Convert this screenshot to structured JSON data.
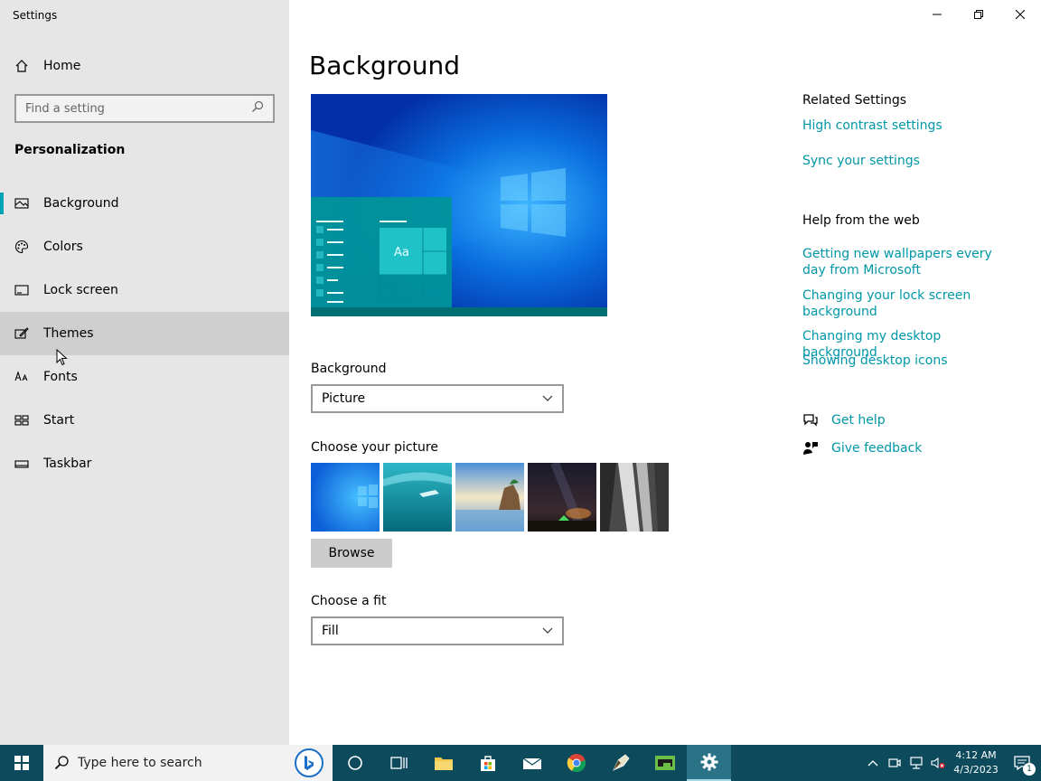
{
  "window": {
    "title": "Settings"
  },
  "sidebar": {
    "home_label": "Home",
    "search_placeholder": "Find a setting",
    "section_title": "Personalization",
    "items": [
      {
        "label": "Background",
        "icon": "picture-icon",
        "selected": true
      },
      {
        "label": "Colors",
        "icon": "palette-icon"
      },
      {
        "label": "Lock screen",
        "icon": "lock-screen-icon"
      },
      {
        "label": "Themes",
        "icon": "themes-icon",
        "hover": true
      },
      {
        "label": "Fonts",
        "icon": "fonts-icon"
      },
      {
        "label": "Start",
        "icon": "start-icon"
      },
      {
        "label": "Taskbar",
        "icon": "taskbar-icon"
      }
    ]
  },
  "main": {
    "title": "Background",
    "preview_tile_text": "Aa",
    "background_label": "Background",
    "background_value": "Picture",
    "choose_picture_label": "Choose your picture",
    "browse_label": "Browse",
    "fit_label": "Choose a fit",
    "fit_value": "Fill"
  },
  "right_pane": {
    "related_title": "Related Settings",
    "related_links": [
      "High contrast settings",
      "Sync your settings"
    ],
    "help_title": "Help from the web",
    "help_links": [
      "Getting new wallpapers every day from Microsoft",
      "Changing your lock screen background",
      "Changing my desktop background",
      "Showing desktop icons"
    ],
    "get_help": "Get help",
    "give_feedback": "Give feedback"
  },
  "taskbar": {
    "search_placeholder": "Type here to search",
    "time": "4:12 AM",
    "date": "4/3/2023",
    "notification_count": "1"
  },
  "colors": {
    "accent": "#0097a7",
    "taskbar": "#0c4a5c",
    "sidebar": "#e6e6e6"
  }
}
